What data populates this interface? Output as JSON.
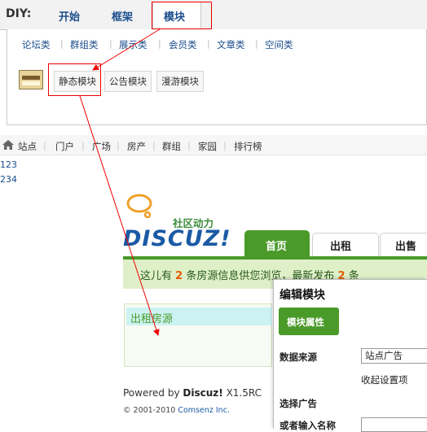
{
  "diy": {
    "label": "DIY:",
    "tabs": [
      {
        "label": "开始"
      },
      {
        "label": "框架"
      },
      {
        "label": "模块",
        "active": true
      }
    ],
    "categories": [
      "论坛类",
      "群组类",
      "展示类",
      "会员类",
      "文章类",
      "空间类"
    ],
    "modules": [
      "静态模块",
      "公告模块",
      "漫游模块"
    ]
  },
  "site_nav": {
    "items": [
      "站点",
      "门户",
      "广场",
      "房产",
      "群组",
      "家园",
      "排行榜"
    ]
  },
  "side_numbers": [
    "123",
    "234"
  ],
  "preview": {
    "logo_text": "DISCUZ!",
    "logo_sub": "社区动力",
    "nav": [
      "首页",
      "出租",
      "出售"
    ],
    "info_prefix": "这儿有",
    "info_count": "2",
    "info_middle": "条房源信息供您浏览，最新发布",
    "info_new": "2",
    "info_suffix": "条",
    "rent_box_title": "出租房源",
    "powered_prefix": "Powered by",
    "powered_brand": "Discuz!",
    "powered_version": "X1.5RC",
    "copyright_prefix": "© 2001-2010",
    "copyright_company": "Comsenz Inc."
  },
  "dialog": {
    "title": "编辑模块",
    "tab": "模块属性",
    "data_source_label": "数据来源",
    "data_source_value": "站点广告",
    "collapse_link": "收起设置项",
    "select_ad_label": "选择广告",
    "input_name_label": "或者输入名称"
  },
  "colors": {
    "accent_green": "#4a9a2a",
    "link_blue": "#1a4d8c",
    "highlight_red": "#e00000",
    "number_orange": "#e35a00"
  }
}
